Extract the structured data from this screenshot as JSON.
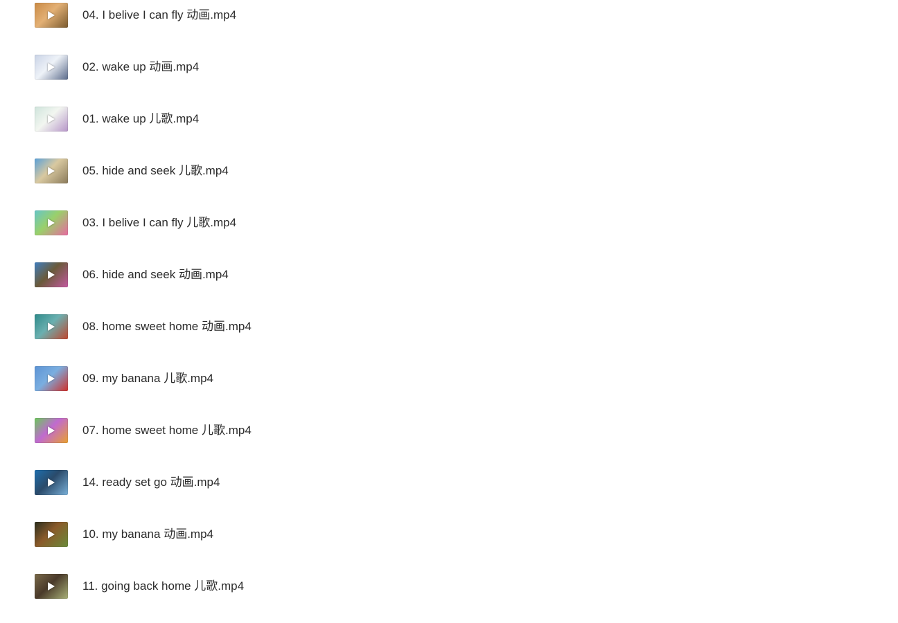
{
  "files": [
    {
      "name": "04. I belive I can fly 动画.mp4",
      "thumb_colors": [
        "#c98a45",
        "#7a5a2e",
        "#e3b074"
      ]
    },
    {
      "name": "02. wake up 动画.mp4",
      "thumb_colors": [
        "#c9d3e6",
        "#5a6a8a",
        "#eef2f8"
      ]
    },
    {
      "name": "01. wake up 儿歌.mp4",
      "thumb_colors": [
        "#cfe4dc",
        "#b695c8",
        "#f2f6f0"
      ]
    },
    {
      "name": "05. hide and seek 儿歌.mp4",
      "thumb_colors": [
        "#5aa0d8",
        "#8a7a5a",
        "#d9c9a0"
      ]
    },
    {
      "name": "03. I belive I can fly 儿歌.mp4",
      "thumb_colors": [
        "#66c6c8",
        "#e86aa0",
        "#9ad06a"
      ]
    },
    {
      "name": "06. hide and seek 动画.mp4",
      "thumb_colors": [
        "#3f7fc0",
        "#c45aa0",
        "#6a5a3a"
      ]
    },
    {
      "name": "08. home sweet home 动画.mp4",
      "thumb_colors": [
        "#2e8a8a",
        "#c0462e",
        "#6ab0b0"
      ]
    },
    {
      "name": "09. my banana 儿歌.mp4",
      "thumb_colors": [
        "#5c93d4",
        "#d0302a",
        "#7aaee0"
      ]
    },
    {
      "name": "07. home sweet home 儿歌.mp4",
      "thumb_colors": [
        "#6ac85a",
        "#e8a030",
        "#c06ad0"
      ]
    },
    {
      "name": "14. ready set go 动画.mp4",
      "thumb_colors": [
        "#1e6fae",
        "#7ab0d8",
        "#2a4a6a"
      ]
    },
    {
      "name": "10. my banana 动画.mp4",
      "thumb_colors": [
        "#2a2e1e",
        "#6a8a3a",
        "#8a5a2a"
      ]
    },
    {
      "name": "11. going back home 儿歌.mp4",
      "thumb_colors": [
        "#7a6a4a",
        "#a8b078",
        "#4a3a2a"
      ]
    }
  ]
}
